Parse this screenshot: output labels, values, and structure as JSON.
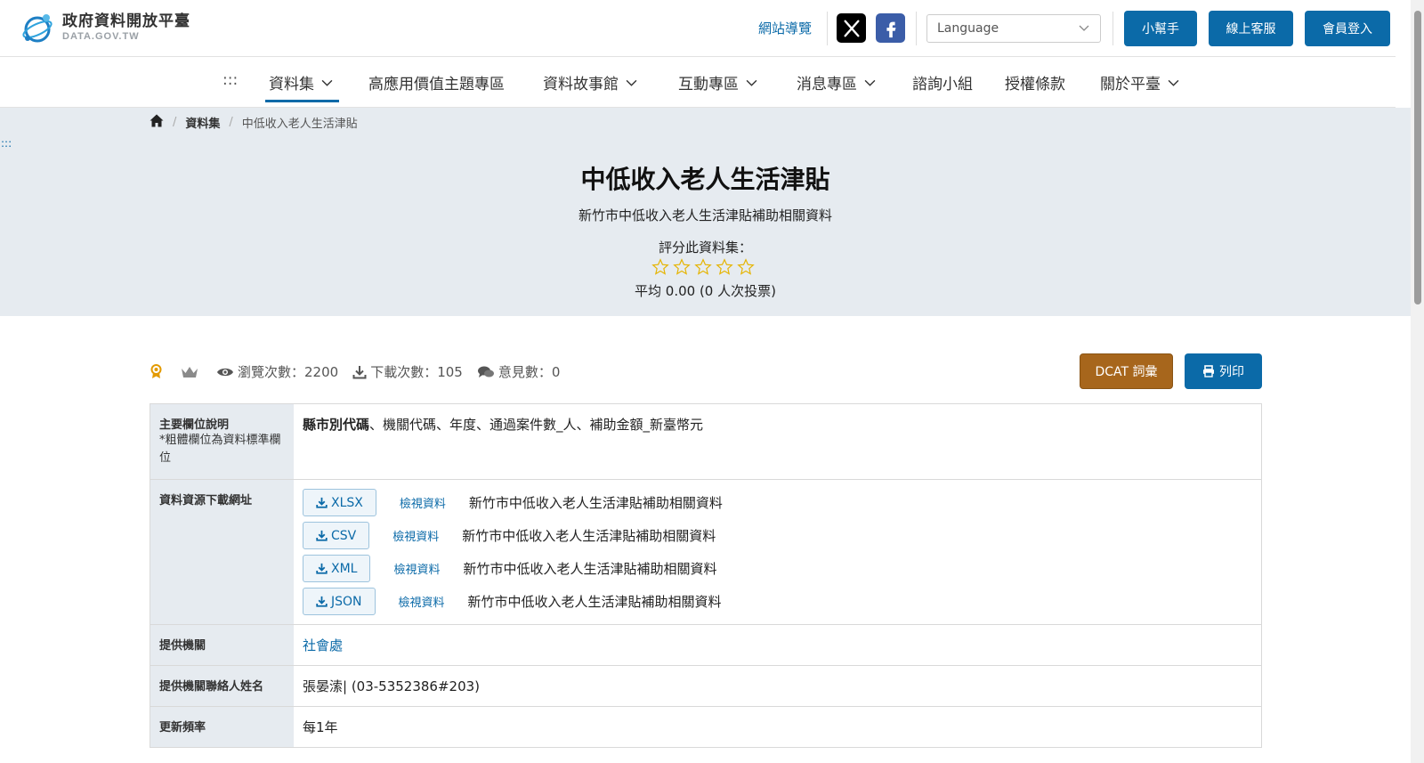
{
  "header": {
    "logo_title": "政府資料開放平臺",
    "logo_sub": "DATA.GOV.TW",
    "sitemap": "網站導覽",
    "language_placeholder": "Language",
    "buttons": [
      "小幫手",
      "線上客服",
      "會員登入"
    ]
  },
  "nav": {
    "dots": ":::",
    "items": [
      "資料集",
      "高應用價值主題專區",
      "資料故事館",
      "互動專區",
      "消息專區",
      "諮詢小組",
      "授權條款",
      "關於平臺"
    ]
  },
  "breadcrumb": {
    "items": [
      "資料集",
      "中低收入老人生活津貼"
    ]
  },
  "side_dots": ":::",
  "dataset": {
    "title": "中低收入老人生活津貼",
    "subtitle": "新竹市中低收入老人生活津貼補助相關資料",
    "rate_prompt": "評分此資料集：",
    "rating_stars": 0,
    "average": "平均 0.00 (0 人次投票)"
  },
  "stats": {
    "views_label": "瀏覽次數：",
    "views": "2200",
    "downloads_label": "下載次數：",
    "downloads": "105",
    "comments_label": "意見數：",
    "comments": "0",
    "dcat_button": "DCAT 詞彙",
    "print_button": "列印"
  },
  "table": {
    "fields_label": "主要欄位說明",
    "fields_note": "*粗體欄位為資料標準欄位",
    "fields_bold": "縣市別代碼",
    "fields_rest": "、機關代碼、年度、通過案件數_人、補助金額_新臺幣元",
    "resources_label": "資料資源下載網址",
    "resources": [
      {
        "format": "XLSX",
        "view": "檢視資料",
        "desc": "新竹市中低收入老人生活津貼補助相關資料"
      },
      {
        "format": "CSV",
        "view": "檢視資料",
        "desc": "新竹市中低收入老人生活津貼補助相關資料"
      },
      {
        "format": "XML",
        "view": "檢視資料",
        "desc": "新竹市中低收入老人生活津貼補助相關資料"
      },
      {
        "format": "JSON",
        "view": "檢視資料",
        "desc": "新竹市中低收入老人生活津貼補助相關資料"
      }
    ],
    "agency_label": "提供機關",
    "agency": "社會處",
    "contact_label": "提供機關聯絡人姓名",
    "contact": "張晏溹| (03-5352386#203)",
    "frequency_label": "更新頻率",
    "frequency": "每1年"
  },
  "colors": {
    "primary": "#0b6aa8",
    "dcat": "#a7661c",
    "hero_bg": "#e6ebf0",
    "star": "#e5b400"
  }
}
